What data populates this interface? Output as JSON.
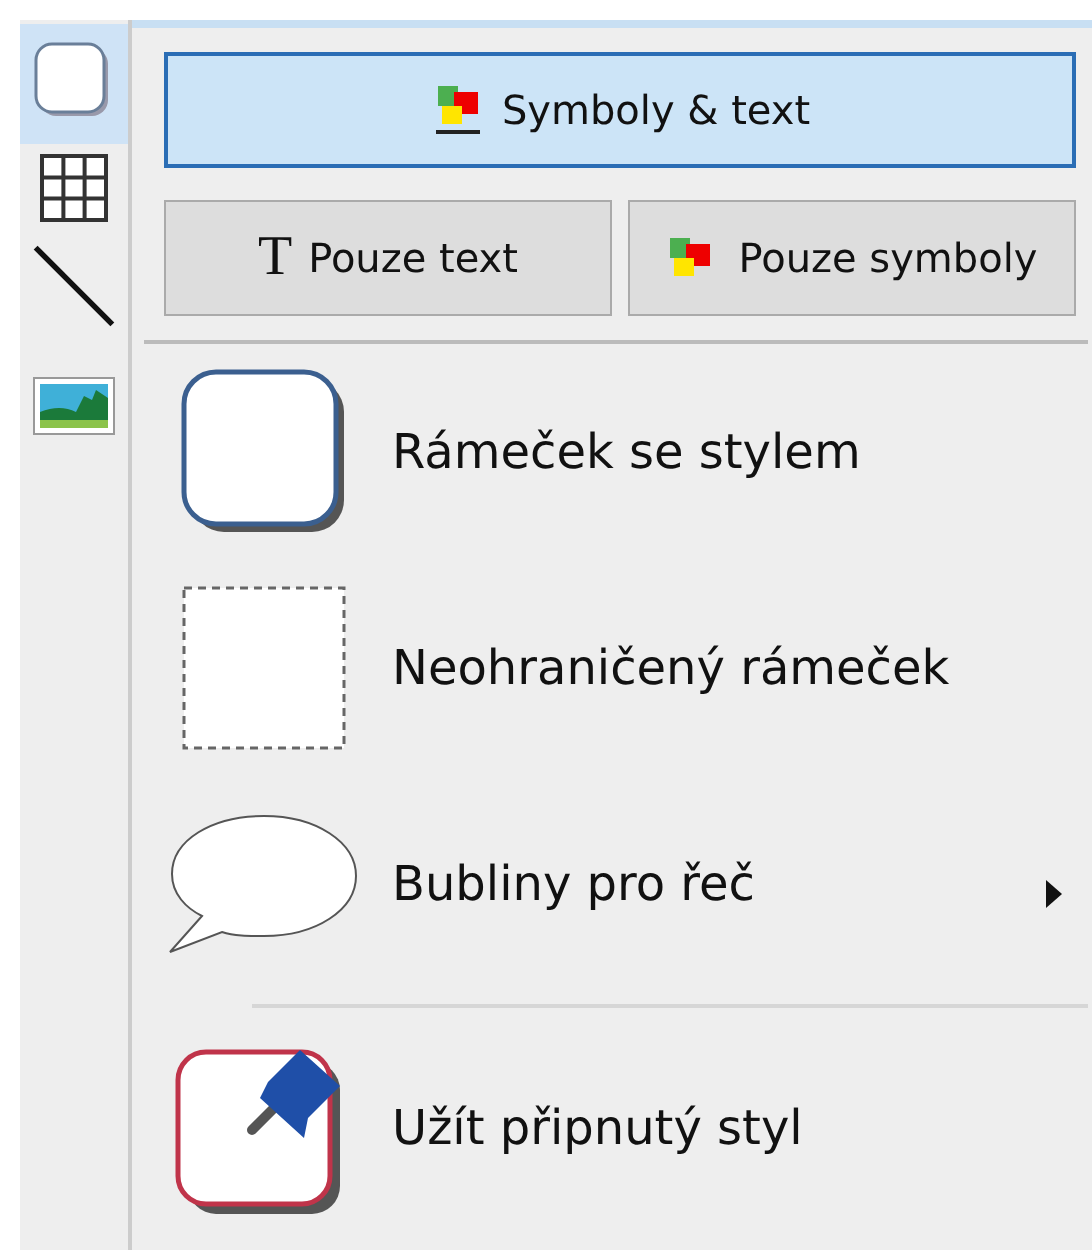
{
  "toolbar": [
    {
      "kind": "frame",
      "selected": true
    },
    {
      "kind": "table",
      "selected": false
    },
    {
      "kind": "line",
      "selected": false
    },
    {
      "kind": "picture",
      "selected": false
    }
  ],
  "modes": [
    {
      "kind": "symbols-text",
      "label": "Symboly & text",
      "selected": true
    },
    {
      "kind": "text",
      "icon_char": "T",
      "label": "Pouze text",
      "selected": false
    },
    {
      "kind": "symbols",
      "label": "Pouze symboly",
      "selected": false
    }
  ],
  "groups": [
    [
      {
        "kind": "styled",
        "label": "Rámeček se stylem",
        "submenu": false
      },
      {
        "kind": "borderless",
        "label": "Neohraničený rámeček",
        "submenu": false
      },
      {
        "kind": "bubble",
        "label": "Bubliny pro řeč",
        "submenu": true
      }
    ],
    [
      {
        "kind": "pinned",
        "label": "Užít připnutý styl",
        "submenu": false
      }
    ]
  ]
}
